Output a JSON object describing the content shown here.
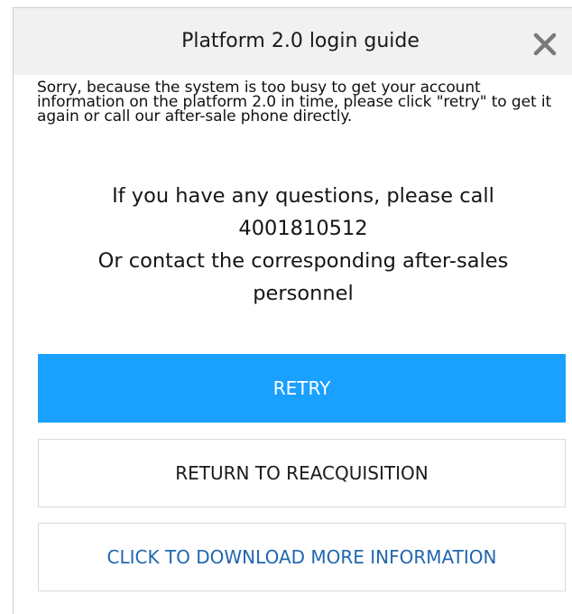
{
  "dialog": {
    "title": "Platform 2.0 login guide",
    "close_icon": "close-icon",
    "message": "Sorry, because the system is too busy to get your account information on the platform 2.0 in time, please click \"retry\" to get it again or call our after-sale phone directly.",
    "contact_line1": "If you have any questions, please call",
    "contact_phone": "4001810512",
    "contact_line2": "Or contact the corresponding after-sales personnel"
  },
  "buttons": {
    "retry_label": "RETRY",
    "return_label": "RETURN TO REACQUISITION",
    "download_label": "CLICK TO DOWNLOAD MORE INFORMATION"
  },
  "colors": {
    "primary": "#1aa0ff",
    "link": "#1f67b0",
    "title_bar": "#f1f1f1"
  }
}
